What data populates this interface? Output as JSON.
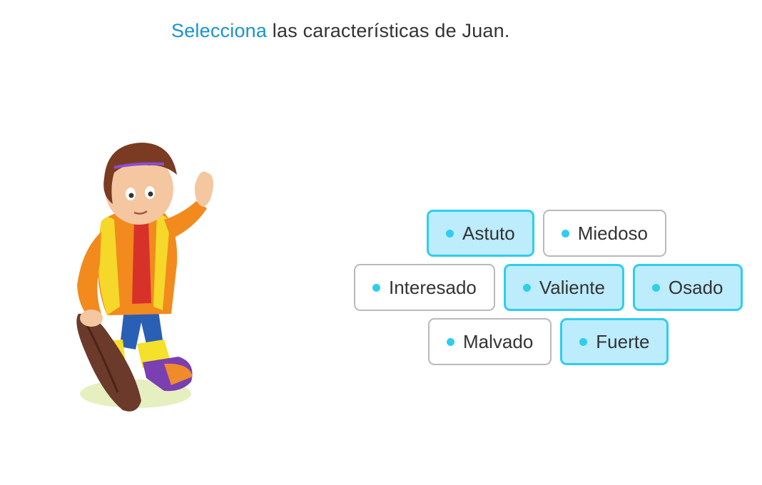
{
  "instruction": {
    "highlight": "Selecciona",
    "rest": " las características de Juan."
  },
  "illustration": {
    "icon": "boy-with-club-illustration"
  },
  "options": [
    {
      "label": "Astuto",
      "selected": true
    },
    {
      "label": "Miedoso",
      "selected": false
    },
    {
      "label": "Interesado",
      "selected": false
    },
    {
      "label": "Valiente",
      "selected": true
    },
    {
      "label": "Osado",
      "selected": true
    },
    {
      "label": "Malvado",
      "selected": false
    },
    {
      "label": "Fuerte",
      "selected": true
    }
  ],
  "colors": {
    "accent": "#1a92cf",
    "selected_fill": "#bdecfc",
    "selected_border": "#2fcdee",
    "unselected_border": "#b9b9b9",
    "dot": "#2fcdee"
  }
}
